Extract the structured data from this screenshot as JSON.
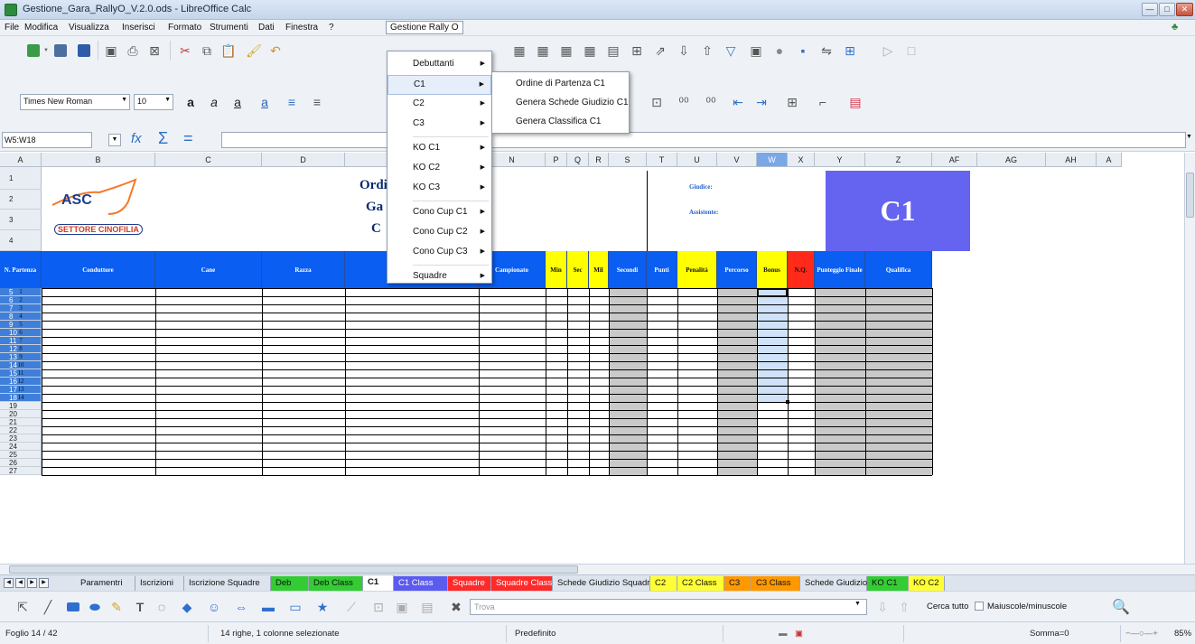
{
  "window": {
    "title": "Gestione_Gara_RallyO_V.2.0.ods - LibreOffice Calc"
  },
  "menubar": [
    "File",
    "Modifica",
    "Visualizza",
    "Inserisci",
    "Formato",
    "Strumenti",
    "Dati",
    "Finestra",
    "?",
    "Gestione Rally O"
  ],
  "toolbar": {
    "font_name": "Times New Roman",
    "font_size": "10"
  },
  "formula": {
    "cell_ref": "W5:W18",
    "content": ""
  },
  "columns": [
    {
      "id": "A",
      "w": 46
    },
    {
      "id": "B",
      "w": 126
    },
    {
      "id": "C",
      "w": 118
    },
    {
      "id": "D",
      "w": 92
    },
    {
      "id": "",
      "w": 148
    },
    {
      "id": "N",
      "w": 74
    },
    {
      "id": "P",
      "w": 24
    },
    {
      "id": "Q",
      "w": 24
    },
    {
      "id": "R",
      "w": 22
    },
    {
      "id": "S",
      "w": 42
    },
    {
      "id": "T",
      "w": 34
    },
    {
      "id": "U",
      "w": 44
    },
    {
      "id": "V",
      "w": 44
    },
    {
      "id": "W",
      "w": 34
    },
    {
      "id": "X",
      "w": 30
    },
    {
      "id": "Y",
      "w": 56
    },
    {
      "id": "Z",
      "w": 74
    },
    {
      "id": "AF",
      "w": 50
    },
    {
      "id": "AG",
      "w": 76
    },
    {
      "id": "AH",
      "w": 56
    },
    {
      "id": "A",
      "w": 28
    }
  ],
  "sheet": {
    "logo": {
      "text": "ASC",
      "subtitle": "SETTORE CINOFILIA"
    },
    "titles": [
      "Ordi",
      "Ga",
      "C"
    ],
    "giudice_label": "Giudice:",
    "assistente_label": "Assistente:",
    "class_badge": "C1",
    "headers": [
      "N. Partenza",
      "Conduttore",
      "Cane",
      "Razza",
      "",
      "Campionato",
      "Min",
      "Sec",
      "Mil",
      "Secondi",
      "Punti",
      "Penalità",
      "Percorso",
      "Bonus",
      "N.Q.",
      "Punteggio Finale",
      "Qualifica"
    ],
    "row_numbers": [
      "1",
      "2",
      "3",
      "4",
      "5",
      "6",
      "7",
      "8",
      "9",
      "10",
      "11",
      "12",
      "13",
      "14",
      "15",
      "16",
      "17",
      "18",
      "19",
      "20",
      "21",
      "22",
      "23",
      "24",
      "25",
      "26",
      "27"
    ],
    "start_numbers": [
      "1",
      "2",
      "3",
      "4",
      "5",
      "6",
      "7",
      "8",
      "9",
      "10",
      "11",
      "12",
      "13",
      "14"
    ]
  },
  "menu_main": {
    "items": [
      {
        "label": "Debuttanti",
        "arrow": true
      },
      {
        "label": "C1",
        "arrow": true,
        "highlight": true
      },
      {
        "label": "C2",
        "arrow": true
      },
      {
        "label": "C3",
        "arrow": true
      },
      {
        "sep": true
      },
      {
        "label": "KO C1",
        "arrow": true
      },
      {
        "label": "KO C2",
        "arrow": true
      },
      {
        "label": "KO C3",
        "arrow": true
      },
      {
        "sep": true
      },
      {
        "label": "Cono Cup C1",
        "arrow": true
      },
      {
        "label": "Cono Cup C2",
        "arrow": true
      },
      {
        "label": "Cono Cup C3",
        "arrow": true
      },
      {
        "sep": true
      },
      {
        "label": "Squadre",
        "arrow": true
      }
    ]
  },
  "menu_sub": {
    "items": [
      "Ordine di Partenza C1",
      "Genera Schede Giudizio C1",
      "Genera Classifica C1"
    ]
  },
  "tabs": [
    {
      "label": "Paramentri",
      "color": "#dde4ee"
    },
    {
      "label": "Iscrizioni",
      "color": "#dde4ee"
    },
    {
      "label": "Iscrizione Squadre",
      "color": "#dde4ee"
    },
    {
      "label": "Deb",
      "color": "#33cc33"
    },
    {
      "label": "Deb Class",
      "color": "#33cc33"
    },
    {
      "label": "C1",
      "color": "#ffffff",
      "active": true
    },
    {
      "label": "C1 Class",
      "color": "#5b5bf0",
      "light": true
    },
    {
      "label": "Squadre",
      "color": "#ff2a2a",
      "light": true
    },
    {
      "label": "Squadre Class",
      "color": "#ff2a2a",
      "light": true
    },
    {
      "label": "Schede Giudizio Squadra",
      "color": "#dde4ee"
    },
    {
      "label": "C2",
      "color": "#ffff33"
    },
    {
      "label": "C2 Class",
      "color": "#ffff33"
    },
    {
      "label": "C3",
      "color": "#ff9900"
    },
    {
      "label": "C3 Class",
      "color": "#ff9900"
    },
    {
      "label": "Schede Giudizio",
      "color": "#dde4ee"
    },
    {
      "label": "KO C1",
      "color": "#33cc33"
    },
    {
      "label": "KO C2",
      "color": "#ffff33"
    }
  ],
  "find": {
    "placeholder": "Trova",
    "find_all": "Cerca tutto",
    "match_case": "Maiuscole/minuscole"
  },
  "status": {
    "sheet": "Foglio 14 / 42",
    "selection": "14 righe, 1 colonne selezionate",
    "style": "Predefinito",
    "sum": "Somma=0",
    "zoom": "85%"
  }
}
